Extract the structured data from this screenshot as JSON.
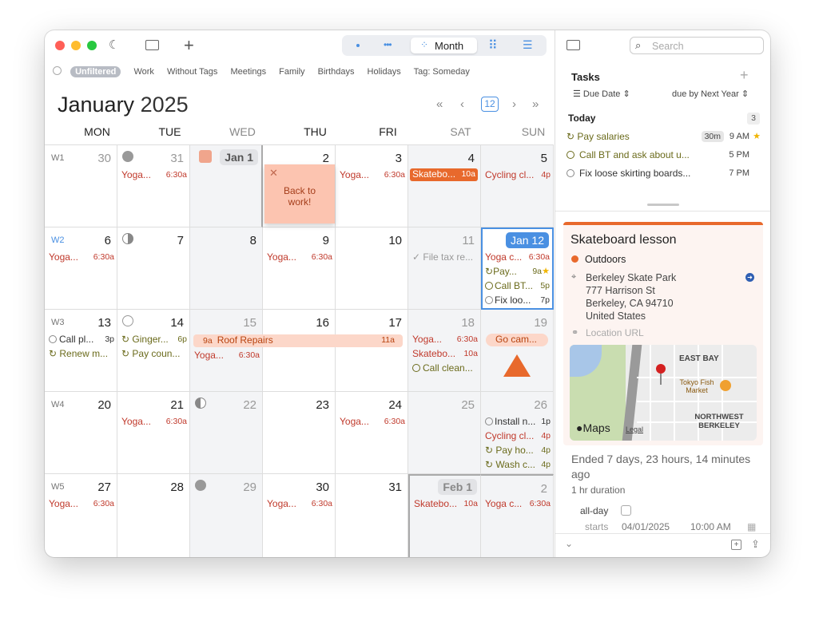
{
  "toolbar": {
    "view_label": "Month"
  },
  "filters": [
    "Unfiltered",
    "Work",
    "Without Tags",
    "Meetings",
    "Family",
    "Birthdays",
    "Holidays",
    "Tag: Someday"
  ],
  "header": {
    "month": "January",
    "year": "2025",
    "today_badge": "12"
  },
  "weekdays": [
    "MON",
    "TUE",
    "WED",
    "THU",
    "FRI",
    "SAT",
    "SUN"
  ],
  "weeks": [
    "W1",
    "W2",
    "W3",
    "W4",
    "W5"
  ],
  "days": {
    "w1": [
      "30",
      "31",
      "Jan 1",
      "2",
      "3",
      "4",
      "5"
    ],
    "w2": [
      "6",
      "7",
      "8",
      "9",
      "10",
      "11",
      "Jan 12"
    ],
    "w3": [
      "13",
      "14",
      "15",
      "16",
      "17",
      "18",
      "19"
    ],
    "w4": [
      "20",
      "21",
      "22",
      "23",
      "24",
      "25",
      "26"
    ],
    "w5": [
      "27",
      "28",
      "29",
      "30",
      "31",
      "Feb 1",
      "2"
    ]
  },
  "events": {
    "yoga": "Yoga...",
    "yoga_c": "Yoga c...",
    "t630": "6:30a",
    "skate": "Skatebo...",
    "t10": "10a",
    "cycling": "Cycling cl...",
    "t4p": "4p",
    "sticky": "Back to work!",
    "file_tax": "File tax re...",
    "pay": "Pay...",
    "t9a": "9a",
    "callbt": "Call BT...",
    "t5p": "5p",
    "fixloo": "Fix loo...",
    "t7p": "7p",
    "callpl": "Call pl...",
    "t3p": "3p",
    "renew": "Renew m...",
    "ginger": "Ginger...",
    "t6p": "6p",
    "paycoun": "Pay coun...",
    "roof": "Roof Repairs",
    "t9a2": "9a",
    "t11a": "11a",
    "callclean": "Call clean...",
    "gocamp": "Go cam...",
    "install": "Install n...",
    "t1p": "1p",
    "cyclingcl": "Cycling cl...",
    "payho": "Pay ho...",
    "washc": "Wash c..."
  },
  "sidebar": {
    "search_placeholder": "Search",
    "tasks_title": "Tasks",
    "sort_label": "Due Date",
    "due_label": "due by Next Year",
    "today_label": "Today",
    "today_count": "3",
    "tasks": [
      {
        "name": "Pay salaries",
        "dur": "30m",
        "time": "9 AM"
      },
      {
        "name": "Call BT and ask about u...",
        "time": "5 PM"
      },
      {
        "name": "Fix loose skirting boards...",
        "time": "7 PM"
      }
    ]
  },
  "detail": {
    "title": "Skateboard lesson",
    "calendar": "Outdoors",
    "location": [
      "Berkeley Skate Park",
      "777 Harrison St",
      "Berkeley, CA  94710",
      "United States"
    ],
    "location_url": "Location URL",
    "map_labels": [
      "EAST BAY",
      "Tokyo Fish Market",
      "NORTHWEST BERKELEY",
      "Maps",
      "Legal"
    ],
    "ended": "Ended 7 days, 23 hours, 14 minutes ago",
    "duration": "1 hr duration",
    "allday_label": "all-day",
    "starts_label": "starts",
    "starts_date": "04/01/2025",
    "starts_time": "10:00 AM"
  },
  "colors": {
    "accent": "#4a90e2",
    "orange": "#e8692c",
    "red_text": "#c0392b",
    "olive": "#6b6b1c"
  }
}
